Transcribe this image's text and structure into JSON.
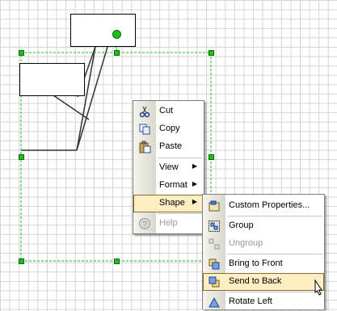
{
  "context_menu": {
    "items": [
      {
        "key": "cut",
        "label": "Cut",
        "icon": "scissors-icon"
      },
      {
        "key": "copy",
        "label": "Copy",
        "icon": "copy-icon"
      },
      {
        "key": "paste",
        "label": "Paste",
        "icon": "paste-icon"
      },
      {
        "key": "view",
        "label": "View",
        "has_submenu": true
      },
      {
        "key": "format",
        "label": "Format",
        "has_submenu": true
      },
      {
        "key": "shape",
        "label": "Shape",
        "has_submenu": true,
        "highlighted": true
      },
      {
        "key": "help",
        "label": "Help",
        "icon": "help-icon",
        "disabled": true
      }
    ]
  },
  "shape_submenu": {
    "items": [
      {
        "key": "custom_properties",
        "label": "Custom Properties...",
        "icon": "custom-properties-icon"
      },
      {
        "key": "group",
        "label": "Group",
        "icon": "group-icon"
      },
      {
        "key": "ungroup",
        "label": "Ungroup",
        "icon": "ungroup-icon",
        "disabled": true
      },
      {
        "key": "bring_to_front",
        "label": "Bring to Front",
        "icon": "bring-to-front-icon"
      },
      {
        "key": "send_to_back",
        "label": "Send to Back",
        "icon": "send-to-back-icon",
        "highlighted": true
      },
      {
        "key": "rotate_left",
        "label": "Rotate Left",
        "icon": "rotate-left-icon"
      }
    ]
  },
  "colors": {
    "selection_handle": "#19c019",
    "menu_highlight": "#ffeec2",
    "menu_gutter": "#d9d8cc"
  }
}
